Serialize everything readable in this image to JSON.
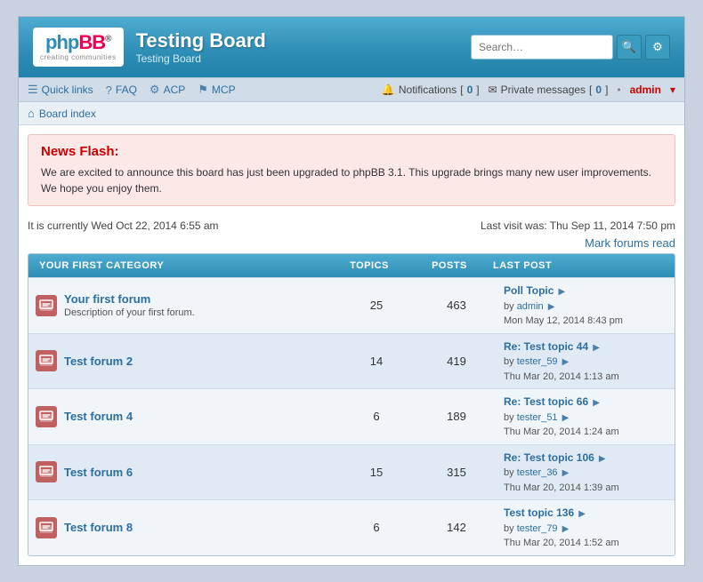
{
  "header": {
    "board_title": "Testing Board",
    "board_subtitle": "Testing Board",
    "search_placeholder": "Search…",
    "search_icon": "🔍",
    "adv_search_icon": "⚙"
  },
  "navbar": {
    "quick_links_label": "Quick links",
    "faq_label": "FAQ",
    "acp_label": "ACP",
    "mcp_label": "MCP",
    "notifications_label": "Notifications",
    "notifications_count": "0",
    "private_messages_label": "Private messages",
    "private_messages_count": "0",
    "admin_label": "admin",
    "dot": "•"
  },
  "breadcrumb": {
    "icon": "⌂",
    "label": "Board index"
  },
  "newsflash": {
    "title": "News Flash:",
    "body": "We are excited to announce this board has just been upgraded to phpBB 3.1. This upgrade brings many new user improvements. We hope you enjoy them."
  },
  "infobar": {
    "current_time": "It is currently Wed Oct 22, 2014 6:55 am",
    "last_visit": "Last visit was: Thu Sep 11, 2014 7:50 pm",
    "mark_forums_read": "Mark forums read"
  },
  "table": {
    "category_label": "YOUR FIRST CATEGORY",
    "col_topics": "TOPICS",
    "col_posts": "POSTS",
    "col_lastpost": "LAST POST",
    "forums": [
      {
        "name": "Your first forum",
        "desc": "Description of your first forum.",
        "topics": "25",
        "posts": "463",
        "lastpost_title": "Poll Topic",
        "lastpost_by": "by",
        "lastpost_user": "admin",
        "lastpost_date": "Mon May 12, 2014 8:43 pm"
      },
      {
        "name": "Test forum 2",
        "desc": "",
        "topics": "14",
        "posts": "419",
        "lastpost_title": "Re: Test topic 44",
        "lastpost_by": "by",
        "lastpost_user": "tester_59",
        "lastpost_date": "Thu Mar 20, 2014 1:13 am"
      },
      {
        "name": "Test forum 4",
        "desc": "",
        "topics": "6",
        "posts": "189",
        "lastpost_title": "Re: Test topic 66",
        "lastpost_by": "by",
        "lastpost_user": "tester_51",
        "lastpost_date": "Thu Mar 20, 2014 1:24 am"
      },
      {
        "name": "Test forum 6",
        "desc": "",
        "topics": "15",
        "posts": "315",
        "lastpost_title": "Re: Test topic 106",
        "lastpost_by": "by",
        "lastpost_user": "tester_36",
        "lastpost_date": "Thu Mar 20, 2014 1:39 am"
      },
      {
        "name": "Test forum 8",
        "desc": "",
        "topics": "6",
        "posts": "142",
        "lastpost_title": "Test topic 136",
        "lastpost_by": "by",
        "lastpost_user": "tester_79",
        "lastpost_date": "Thu Mar 20, 2014 1:52 am"
      }
    ]
  },
  "colors": {
    "accent_blue": "#2e8db5",
    "link_blue": "#2e6ea0",
    "error_red": "#cc0000"
  }
}
